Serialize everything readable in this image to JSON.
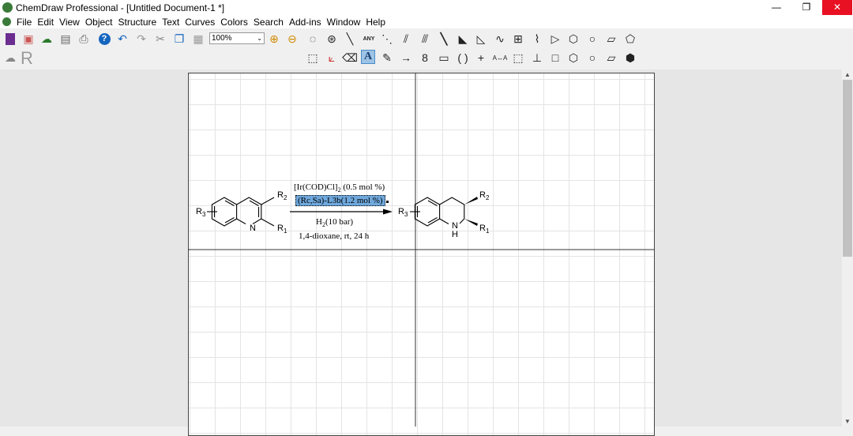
{
  "window": {
    "title": "ChemDraw Professional - [Untitled Document-1 *]",
    "minimize": "—",
    "restore": "❐",
    "close": "✕"
  },
  "menu": [
    "File",
    "Edit",
    "View",
    "Object",
    "Structure",
    "Text",
    "Curves",
    "Colors",
    "Search",
    "Add-ins",
    "Window",
    "Help"
  ],
  "toolbar": {
    "zoom_value": "100%",
    "logo_letter": "R"
  },
  "scheme": {
    "reagent1": "[Ir(COD)Cl]",
    "reagent1_sub": "2",
    "reagent1_tail": " (0.5 mol %)",
    "ligand": "(Rc,Sa)-L3b(1.2 mol %)",
    "h2": "H",
    "h2_sub": "2",
    "h2_tail": "(10 bar)",
    "conditions": "1,4-dioxane, rt, 24 h",
    "labels": {
      "R": "R",
      "one": "1",
      "two": "2",
      "three": "3",
      "N": "N",
      "H": "H"
    }
  },
  "colors": {
    "selection": "#6fa8dc",
    "close_hover": "#e81123"
  }
}
